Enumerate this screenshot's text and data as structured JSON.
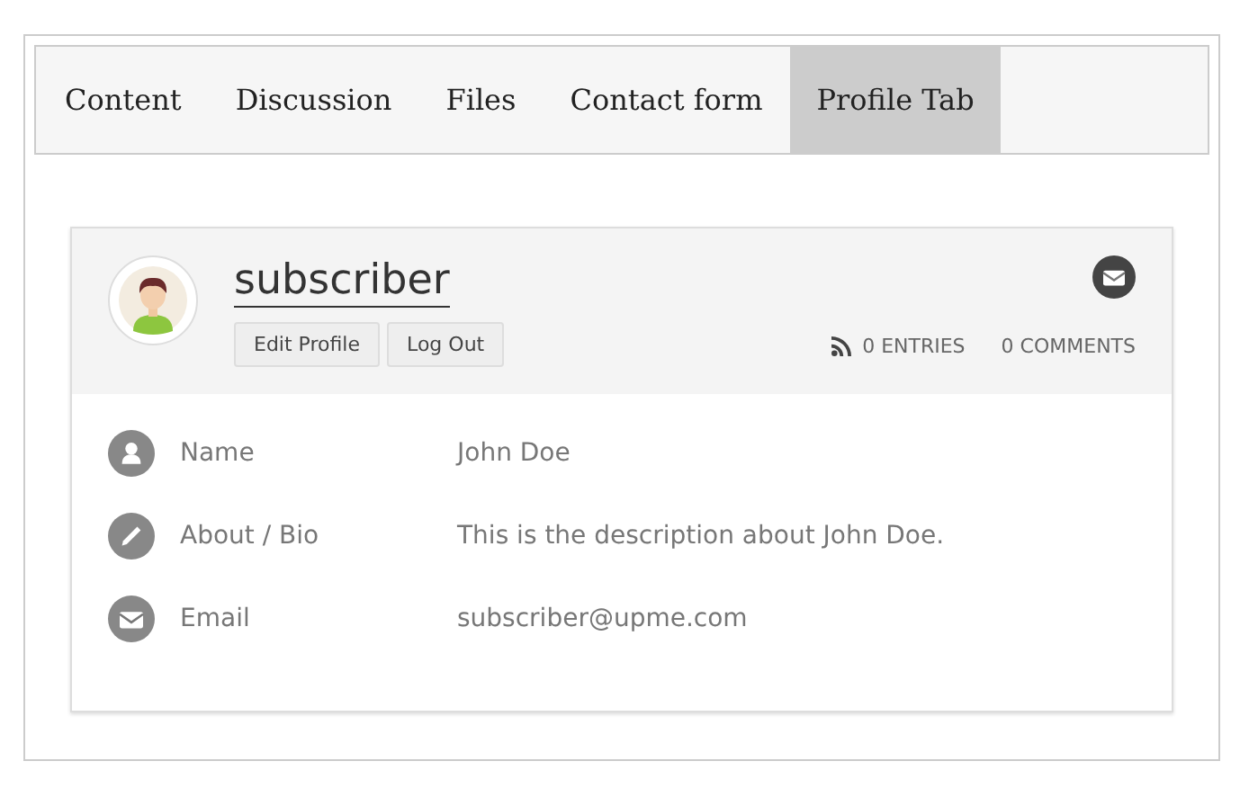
{
  "tabs": [
    {
      "label": "Content",
      "selected": false
    },
    {
      "label": "Discussion",
      "selected": false
    },
    {
      "label": "Files",
      "selected": false
    },
    {
      "label": "Contact form",
      "selected": false
    },
    {
      "label": "Profile Tab",
      "selected": true
    }
  ],
  "profile": {
    "username": "subscriber",
    "buttons": [
      "Edit Profile",
      "Log Out"
    ],
    "entries": "0 ENTRIES",
    "comments": "0 COMMENTS"
  },
  "fields": [
    {
      "kind": "user",
      "label": "Name",
      "value": "John Doe"
    },
    {
      "kind": "pencil",
      "label": "About / Bio",
      "value": "This is the description about John Doe."
    },
    {
      "kind": "mail",
      "label": "Email",
      "value": "subscriber@upme.com"
    }
  ]
}
